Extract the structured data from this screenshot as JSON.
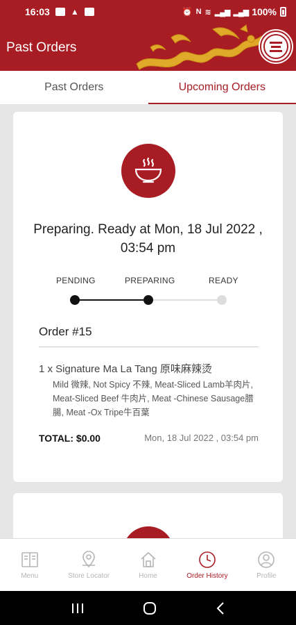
{
  "status_bar": {
    "time": "16:03",
    "battery": "100%"
  },
  "app_bar": {
    "title": "Past Orders"
  },
  "tabs": [
    {
      "label": "Past Orders",
      "active": false
    },
    {
      "label": "Upcoming Orders",
      "active": true
    }
  ],
  "order": {
    "status_text": "Preparing. Ready at Mon, 18 Jul 2022 , 03:54 pm",
    "steps": [
      "PENDING",
      "PREPARING",
      "READY"
    ],
    "current_step_index": 1,
    "order_number": "Order #15",
    "item": "1 x Signature Ma La Tang 原味麻辣烫",
    "item_options": "Mild 微辣, Not Spicy 不辣, Meat-Sliced Lamb羊肉片, Meat-Sliced Beef 牛肉片, Meat -Chinese Sausage腊腸, Meat -Ox Tripe牛百葉",
    "total": "TOTAL: $0.00",
    "datetime": "Mon, 18 Jul 2022 , 03:54 pm"
  },
  "bottom_nav": [
    {
      "label": "Menu",
      "icon": "menu-book-icon",
      "active": false
    },
    {
      "label": "Store Locator",
      "icon": "map-pin-icon",
      "active": false
    },
    {
      "label": "Home",
      "icon": "home-icon",
      "active": false
    },
    {
      "label": "Order History",
      "icon": "clock-icon",
      "active": true
    },
    {
      "label": "Profile",
      "icon": "profile-icon",
      "active": false
    }
  ],
  "colors": {
    "brand": "#a81c24",
    "inactive": "#b5b5b5"
  }
}
